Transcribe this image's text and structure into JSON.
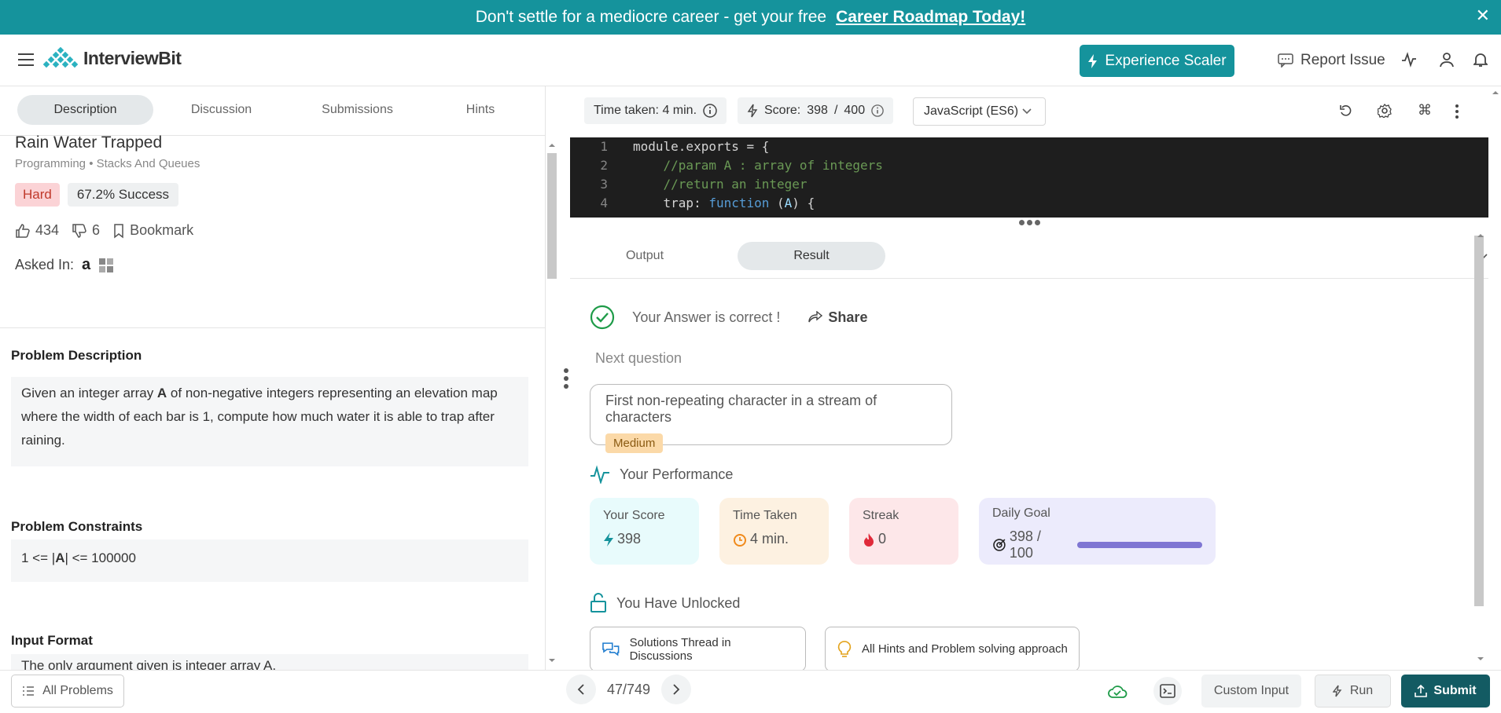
{
  "banner": {
    "text": "Don't settle for a mediocre career - get your free",
    "link": "Career Roadmap Today!",
    "close": "✕"
  },
  "header": {
    "logo": "InterviewBit",
    "experience_btn": "Experience Scaler",
    "report_issue": "Report Issue"
  },
  "left_tabs": [
    "Description",
    "Discussion",
    "Submissions",
    "Hints"
  ],
  "problem": {
    "title": "Rain Water Trapped",
    "breadcrumb": "Programming • Stacks And Queues",
    "difficulty": "Hard",
    "success": "67.2% Success",
    "likes": "434",
    "dislikes": "6",
    "bookmark": "Bookmark",
    "asked_in": "Asked In:",
    "amazon_glyph": "a"
  },
  "sections": {
    "desc_title": "Problem Description",
    "desc_pre": "Given an integer array ",
    "desc_bold": "A",
    "desc_post": " of non-negative integers representing an elevation map where the width of each bar is 1, compute how much water it is able to trap after raining.",
    "constraints_title": "Problem Constraints",
    "constraints_pre": "1 <= |",
    "constraints_bold": "A",
    "constraints_post": "| <= 100000",
    "input_title": "Input Format",
    "input_text": "The only argument given is integer array A."
  },
  "toolbar": {
    "time_taken": "Time taken: 4 min.",
    "score_label": "Score:",
    "score_value": "398",
    "score_sep": "/",
    "score_max": "400",
    "language": "JavaScript (ES6)"
  },
  "editor": {
    "line_numbers": [
      "1",
      "2",
      "3",
      "4"
    ],
    "line1": "module.exports = {",
    "line2": "    //param A : array of integers",
    "line3": "    //return an integer",
    "line4_pre": "    trap: ",
    "line4_kw": "function",
    "line4_mid": " (",
    "line4_param": "A",
    "line4_post": ") {"
  },
  "result_tabs": [
    "Output",
    "Result"
  ],
  "result": {
    "correct": "Your Answer is correct !",
    "share": "Share",
    "next_question_label": "Next question",
    "next_question_title": "First non-repeating character in a stream of characters",
    "next_question_difficulty": "Medium",
    "performance_title": "Your Performance",
    "score_label": "Your Score",
    "score_value": "398",
    "time_label": "Time Taken",
    "time_value": "4 min.",
    "streak_label": "Streak",
    "streak_value": "0",
    "goal_label": "Daily Goal",
    "goal_value": "398 / 100",
    "goal_progress": 1.0,
    "unlocked_title": "You Have Unlocked",
    "unlocked_items": [
      "Solutions Thread in Discussions",
      "All Hints and Problem solving approach"
    ]
  },
  "footer": {
    "all_problems": "All Problems",
    "page": "47/749",
    "custom_input": "Custom Input",
    "run": "Run",
    "submit": "Submit"
  },
  "colors": {
    "brand": "#15939c",
    "submit": "#135b63",
    "hard_bg": "#fbd3d6",
    "medium_bg": "#fbd9a8",
    "score_card": "#e8fbfc",
    "time_card": "#fdf1e1",
    "streak_card": "#fde7e9",
    "goal_card": "#ecebfc",
    "goal_bar": "#7f76d3"
  }
}
